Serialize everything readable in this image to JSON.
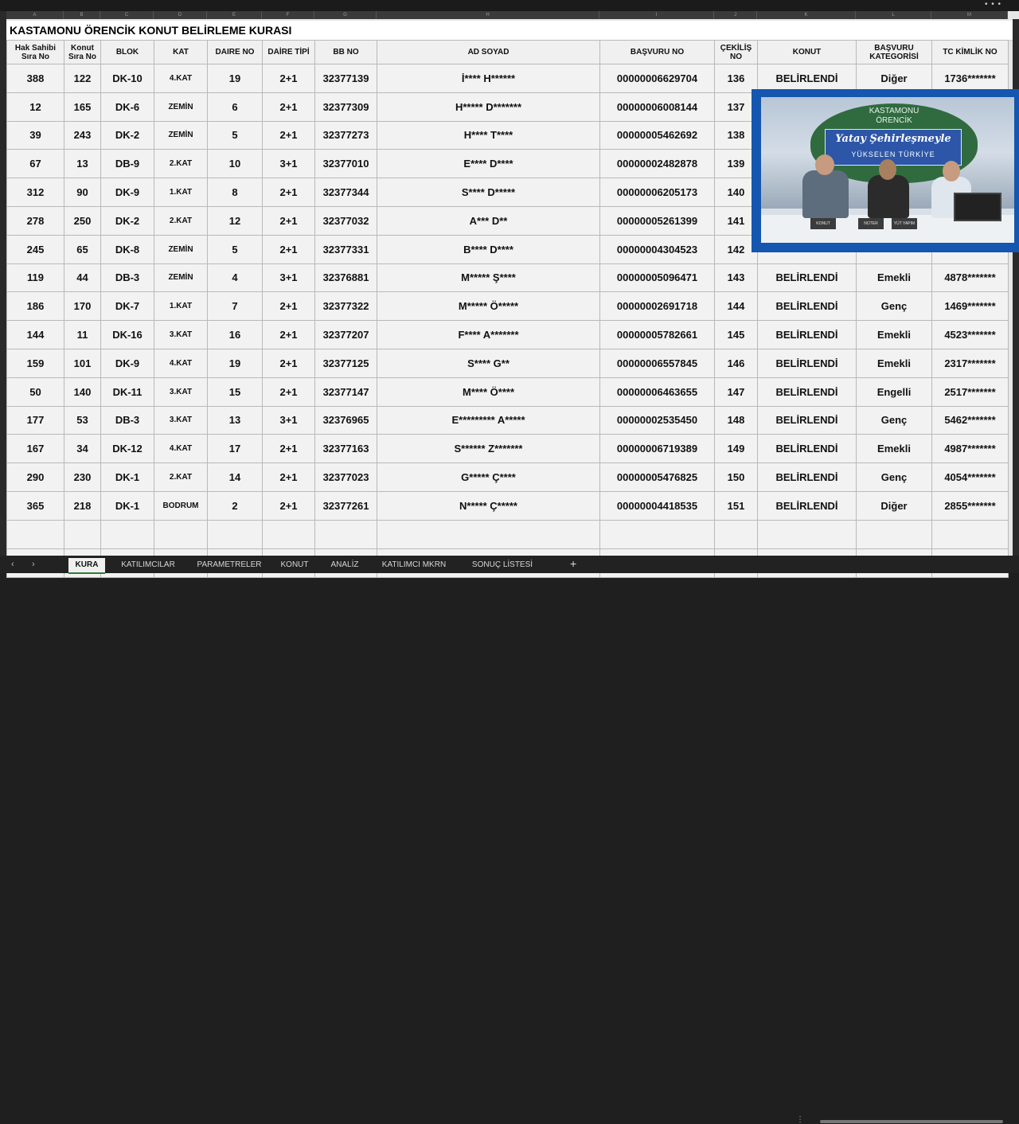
{
  "title": "KASTAMONU ÖRENCİK KONUT BELİRLEME KURASI",
  "col_letters": [
    "A",
    "B",
    "C",
    "D",
    "E",
    "F",
    "G",
    "H",
    "I",
    "J",
    "K",
    "L",
    "M"
  ],
  "headers": [
    "Hak Sahibi Sıra No",
    "Konut Sıra No",
    "BLOK",
    "KAT",
    "DAIRE NO",
    "DAİRE TİPİ",
    "BB NO",
    "AD SOYAD",
    "BAŞVURU NO",
    "ÇEKİLİŞ NO",
    "KONUT",
    "BAŞVURU KATEGORİSİ",
    "TC KİMLİK NO"
  ],
  "rows": [
    [
      "388",
      "122",
      "DK-10",
      "4.KAT",
      "19",
      "2+1",
      "32377139",
      "İ**** H******",
      "00000006629704",
      "136",
      "BELİRLENDİ",
      "Diğer",
      "1736*******"
    ],
    [
      "12",
      "165",
      "DK-6",
      "ZEMİN",
      "6",
      "2+1",
      "32377309",
      "H***** D*******",
      "00000006008144",
      "137",
      "",
      "",
      ""
    ],
    [
      "39",
      "243",
      "DK-2",
      "ZEMİN",
      "5",
      "2+1",
      "32377273",
      "H**** T****",
      "00000005462692",
      "138",
      "",
      "",
      ""
    ],
    [
      "67",
      "13",
      "DB-9",
      "2.KAT",
      "10",
      "3+1",
      "32377010",
      "E**** D****",
      "00000002482878",
      "139",
      "",
      "",
      ""
    ],
    [
      "312",
      "90",
      "DK-9",
      "1.KAT",
      "8",
      "2+1",
      "32377344",
      "S**** D*****",
      "00000006205173",
      "140",
      "",
      "",
      ""
    ],
    [
      "278",
      "250",
      "DK-2",
      "2.KAT",
      "12",
      "2+1",
      "32377032",
      "A*** D**",
      "00000005261399",
      "141",
      "",
      "",
      ""
    ],
    [
      "245",
      "65",
      "DK-8",
      "ZEMİN",
      "5",
      "2+1",
      "32377331",
      "B**** D****",
      "00000004304523",
      "142",
      "",
      "",
      ""
    ],
    [
      "119",
      "44",
      "DB-3",
      "ZEMİN",
      "4",
      "3+1",
      "32376881",
      "M***** Ş****",
      "00000005096471",
      "143",
      "BELİRLENDİ",
      "Emekli",
      "4878*******"
    ],
    [
      "186",
      "170",
      "DK-7",
      "1.KAT",
      "7",
      "2+1",
      "32377322",
      "M***** Ö*****",
      "00000002691718",
      "144",
      "BELİRLENDİ",
      "Genç",
      "1469*******"
    ],
    [
      "144",
      "11",
      "DK-16",
      "3.KAT",
      "16",
      "2+1",
      "32377207",
      "F**** A*******",
      "00000005782661",
      "145",
      "BELİRLENDİ",
      "Emekli",
      "4523*******"
    ],
    [
      "159",
      "101",
      "DK-9",
      "4.KAT",
      "19",
      "2+1",
      "32377125",
      "S**** G**",
      "00000006557845",
      "146",
      "BELİRLENDİ",
      "Emekli",
      "2317*******"
    ],
    [
      "50",
      "140",
      "DK-11",
      "3.KAT",
      "15",
      "2+1",
      "32377147",
      "M**** Ö****",
      "00000006463655",
      "147",
      "BELİRLENDİ",
      "Engelli",
      "2517*******"
    ],
    [
      "177",
      "53",
      "DB-3",
      "3.KAT",
      "13",
      "3+1",
      "32376965",
      "E********* A*****",
      "00000002535450",
      "148",
      "BELİRLENDİ",
      "Genç",
      "5462*******"
    ],
    [
      "167",
      "34",
      "DK-12",
      "4.KAT",
      "17",
      "2+1",
      "32377163",
      "S****** Z*******",
      "00000006719389",
      "149",
      "BELİRLENDİ",
      "Emekli",
      "4987*******"
    ],
    [
      "290",
      "230",
      "DK-1",
      "2.KAT",
      "14",
      "2+1",
      "32377023",
      "G***** Ç****",
      "00000005476825",
      "150",
      "BELİRLENDİ",
      "Genç",
      "4054*******"
    ],
    [
      "365",
      "218",
      "DK-1",
      "BODRUM",
      "2",
      "2+1",
      "32377261",
      "N***** Ç*****",
      "00000004418535",
      "151",
      "BELİRLENDİ",
      "Diğer",
      "2855*******"
    ]
  ],
  "video": {
    "line1": "KASTAMONU",
    "line2": "ÖRENCİK",
    "slogan": "Yatay Şehirleşmeyle",
    "slogan2": "YÜKSELEN TÜRKİYE",
    "plates": [
      "KONUT",
      "NOTER",
      "YÜT YAPIM"
    ]
  },
  "tabs": [
    "KURA",
    "KATILIMCILAR",
    "PARAMETRELER",
    "KONUT",
    "ANALİZ",
    "KATILIMCI MKRN",
    "SONUÇ LİSTESİ"
  ],
  "active_tab": "KURA",
  "colors": {
    "panel_blue": "#1456b0",
    "grid_bg": "#f2f2f2",
    "active_tab_accent": "#2e7d32"
  }
}
